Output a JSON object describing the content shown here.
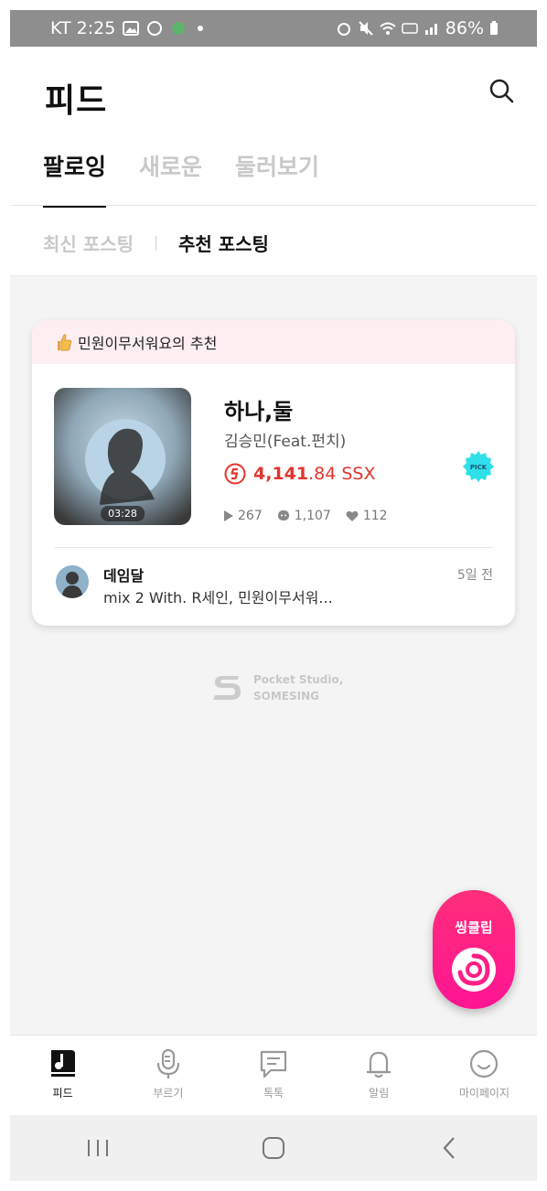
{
  "status_bar": {
    "carrier_time": "KT 2:25",
    "battery": "86%"
  },
  "header": {
    "title": "피드",
    "search_icon": "search-icon"
  },
  "tabs": [
    {
      "label": "팔로잉",
      "active": true
    },
    {
      "label": "새로운",
      "active": false
    },
    {
      "label": "둘러보기",
      "active": false
    }
  ],
  "sub_tabs": [
    {
      "label": "최신 포스팅",
      "active": false
    },
    {
      "label": "추천 포스팅",
      "active": true
    }
  ],
  "card": {
    "recommendation": "민원이무서워요의 추천",
    "song_title": "하나,둘",
    "artist": "김승민(Feat.펀치)",
    "duration": "03:28",
    "price_int": "4,141",
    "price_rest": ".84 SSX",
    "badge": "PICK",
    "plays": "267",
    "comments": "1,107",
    "likes": "112",
    "poster_name": "데임달",
    "poster_message": "mix 2 With. R세인, 민원이무서워...",
    "poster_time": "5일 전"
  },
  "footer_logo": {
    "line1": "Pocket Studio,",
    "line2": "SOMESING"
  },
  "fab": {
    "label": "씽클립"
  },
  "bottom_nav": [
    {
      "label": "피드",
      "icon": "feed-icon",
      "active": true
    },
    {
      "label": "부르기",
      "icon": "mic-icon",
      "active": false
    },
    {
      "label": "톡톡",
      "icon": "chat-icon",
      "active": false
    },
    {
      "label": "알림",
      "icon": "bell-icon",
      "active": false
    },
    {
      "label": "마이페이지",
      "icon": "profile-icon",
      "active": false
    }
  ],
  "colors": {
    "accent": "#e2352f",
    "fab": "#ff1f86",
    "card_header_bg": "#fdeef2"
  }
}
